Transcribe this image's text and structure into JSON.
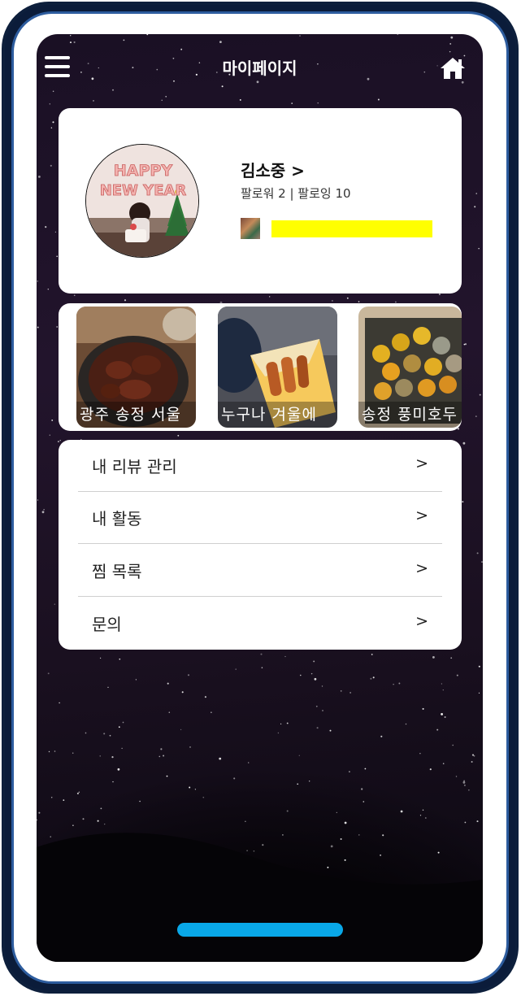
{
  "header": {
    "title": "마이페이지",
    "menu_icon": "hamburger-menu-icon",
    "home_icon": "home-icon"
  },
  "profile": {
    "name": "김소중 >",
    "follow_info": "팔로워 2 | 팔로잉 10",
    "avatar_text_line1": "HAPPY",
    "avatar_text_line2": "NEW YEAR",
    "highlight_color": "#ffff00"
  },
  "photos": [
    {
      "caption": "광주 송정 서울"
    },
    {
      "caption": "누구나 겨울에"
    },
    {
      "caption": "송정 풍미호두"
    }
  ],
  "menu": [
    {
      "label": "내 리뷰 관리",
      "arrow": ">"
    },
    {
      "label": "내 활동",
      "arrow": ">"
    },
    {
      "label": "찜 목록",
      "arrow": ">"
    },
    {
      "label": "문의",
      "arrow": ">"
    }
  ],
  "colors": {
    "home_indicator": "#09a8e8",
    "phone_frame": "#0d1f3c",
    "phone_frame_accent": "#2d5c9e"
  }
}
